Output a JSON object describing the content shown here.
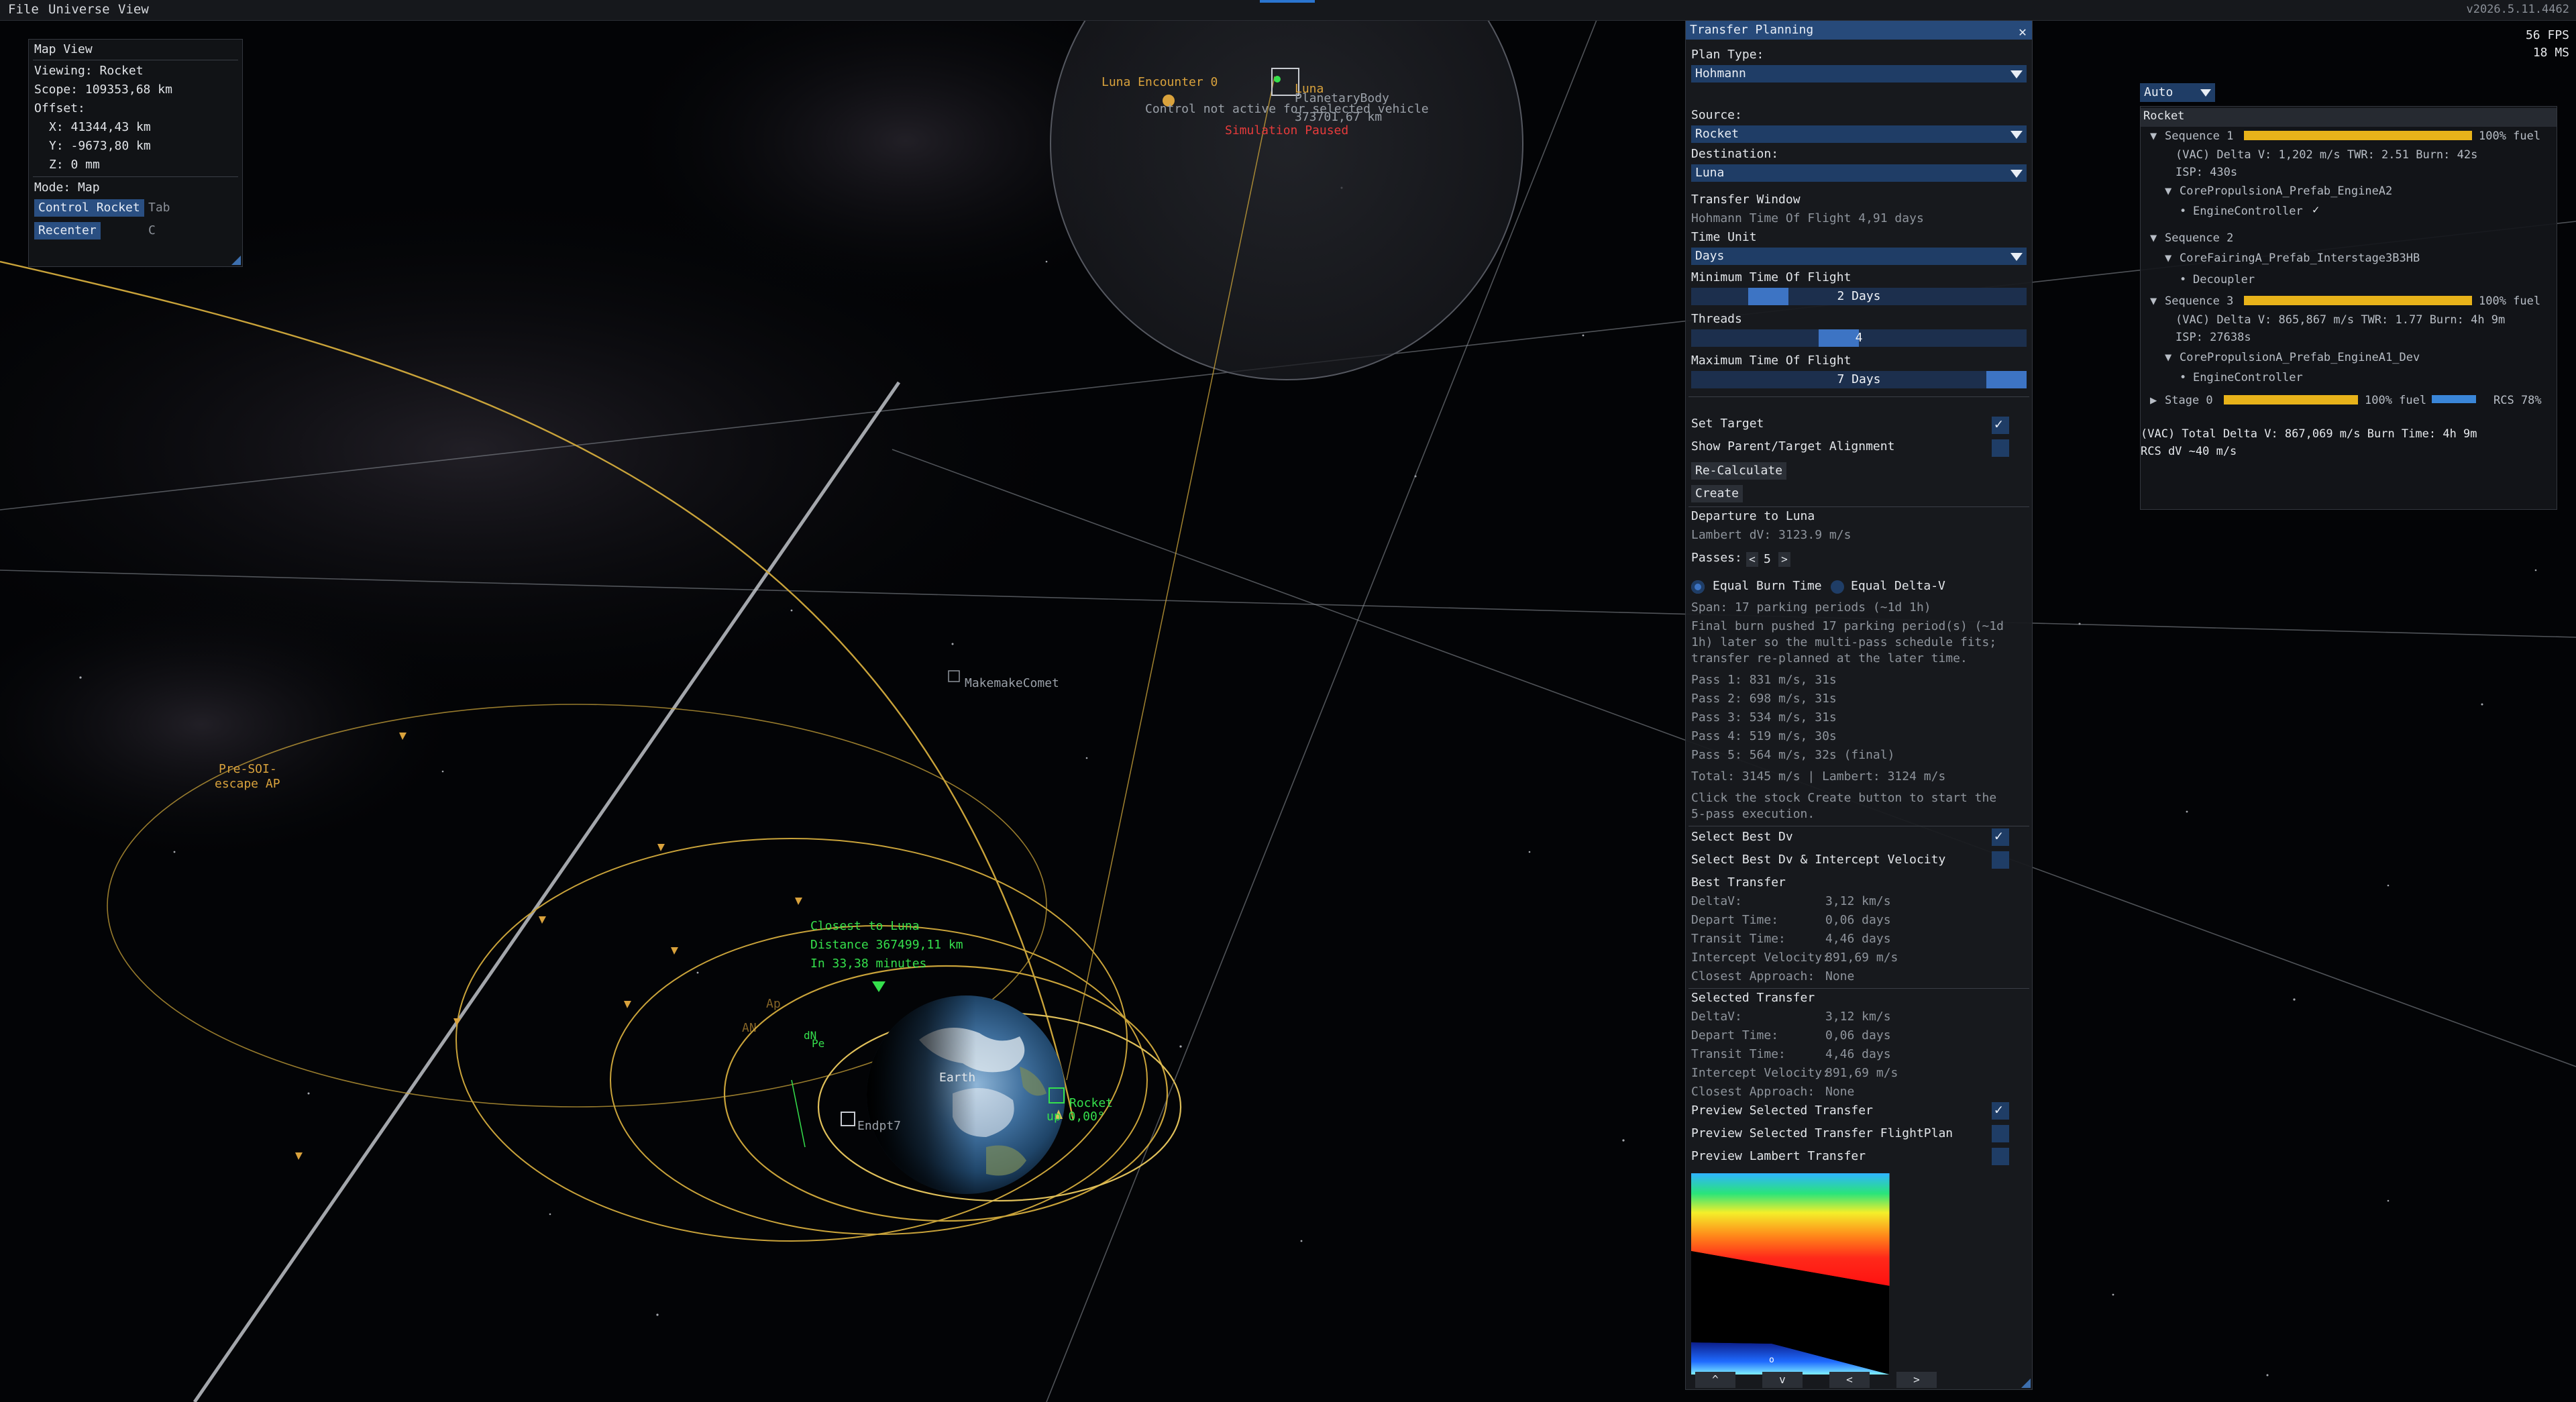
{
  "menu": {
    "file": "File",
    "universe": "Universe",
    "view": "View"
  },
  "version": "v2026.5.11.4462",
  "perf": {
    "fps": "56 FPS",
    "ms": "18 MS"
  },
  "map_view": {
    "title": "Map View",
    "viewing": "Viewing: Rocket",
    "scope": "Scope: 109353,68 km",
    "offset": "Offset:",
    "x": "X: 41344,43 km",
    "y": "Y: -9673,80 km",
    "z": "Z: 0 mm",
    "mode": "Mode: Map",
    "control_rocket": "Control Rocket",
    "control_key": "Tab",
    "recenter": "Recenter",
    "recenter_key": "C"
  },
  "scene": {
    "luna_encounter": "Luna Encounter 0",
    "luna": "Luna",
    "planetary_body": "PlanetaryBody",
    "distance": "373701,67 km",
    "control_not_active": "Control not active for selected vehicle",
    "sim_paused": "Simulation Paused",
    "makemake": "MakemakeComet",
    "pre_soi_1": "Pre-SOI-",
    "pre_soi_2": "escape AP",
    "closest_1": "Closest to Luna",
    "closest_2": "Distance 367499,11 km",
    "closest_3": "In 33,38 minutes",
    "earth": "Earth",
    "ap": "Ap",
    "an": "AN",
    "dn": "dN",
    "pe": "Pe",
    "rocket": "Rocket",
    "rocket_angle": "up 0,00°",
    "endpt": "Endpt7"
  },
  "transfer": {
    "title": "Transfer Planning",
    "plan_type_label": "Plan Type:",
    "plan_type": "Hohmann",
    "source_label": "Source:",
    "source": "Rocket",
    "destination_label": "Destination:",
    "destination": "Luna",
    "window_label": "Transfer Window",
    "hohmann_tof": "Hohmann Time Of Flight 4,91 days",
    "time_unit_label": "Time Unit",
    "time_unit": "Days",
    "min_tof_label": "Minimum Time Of Flight",
    "min_tof": "2 Days",
    "min_tof_frac": 0.29,
    "threads_label": "Threads",
    "threads": "4",
    "threads_frac": 0.5,
    "max_tof_label": "Maximum Time Of Flight",
    "max_tof": "7 Days",
    "max_tof_frac": 1.0,
    "set_target": "Set Target",
    "show_alignment": "Show Parent/Target Alignment",
    "recalculate": "Re-Calculate",
    "create": "Create",
    "departure": "Departure to Luna",
    "lambert_dv": "Lambert dV: 3123.9 m/s",
    "passes_label": "Passes:",
    "passes": "5",
    "equal_burn": "Equal Burn Time",
    "equal_dv": "Equal Delta-V",
    "span": "Span: 17 parking periods (~1d 1h)",
    "final_1": "Final burn pushed 17 parking period(s) (~1d",
    "final_2": "1h) later so the multi-pass schedule fits;",
    "final_3": "transfer re-planned at the later time.",
    "pass1": "Pass 1: 831 m/s, 31s",
    "pass2": "Pass 2: 698 m/s, 31s",
    "pass3": "Pass 3: 534 m/s, 31s",
    "pass4": "Pass 4: 519 m/s, 30s",
    "pass5": "Pass 5: 564 m/s, 32s (final)",
    "total": "Total: 3145 m/s | Lambert: 3124 m/s",
    "click_1": "Click the stock Create button to start the",
    "click_2": "5-pass execution.",
    "select_best_dv": "Select Best Dv",
    "select_best_dv_iv": "Select Best Dv & Intercept Velocity",
    "best_transfer": "Best Transfer",
    "selected_transfer": "Selected Transfer",
    "k_deltav": "DeltaV:",
    "k_depart": "Depart Time:",
    "k_transit": "Transit Time:",
    "k_intercept": "Intercept Velocity:",
    "k_closest": "Closest Approach:",
    "best": {
      "deltav": "3,12 km/s",
      "depart": "0,06 days",
      "transit": "4,46 days",
      "intercept": "891,69 m/s",
      "closest": "None"
    },
    "selected": {
      "deltav": "3,12 km/s",
      "depart": "0,06 days",
      "transit": "4,46 days",
      "intercept": "891,69 m/s",
      "closest": "None"
    },
    "preview_selected": "Preview Selected Transfer",
    "preview_flightplan": "Preview Selected Transfer FlightPlan",
    "preview_lambert": "Preview Lambert Transfer",
    "heat_marker": "o",
    "nav_up": "^",
    "nav_down": "v",
    "nav_left": "<",
    "nav_right": ">",
    "dec": "<",
    "inc": ">"
  },
  "staging": {
    "mode": "Auto",
    "vehicle": "Rocket",
    "seq1": "Sequence 1",
    "seq1_fuel": "100% fuel",
    "seq1_fill": 1.0,
    "seq1_vac": "(VAC) Delta V: 1,202 m/s  TWR: 2.51  Burn: 42s",
    "seq1_isp": "ISP: 430s",
    "engine_a2": "CorePropulsionA_Prefab_EngineA2",
    "engine_controller_1": "EngineController",
    "seq2": "Sequence 2",
    "fairing": "CoreFairingA_Prefab_Interstage3B3HB",
    "decoupler": "Decoupler",
    "seq3": "Sequence 3",
    "seq3_fuel": "100% fuel",
    "seq3_fill": 1.0,
    "seq3_vac": "(VAC) Delta V: 865,867 m/s  TWR: 1.77  Burn: 4h 9m",
    "seq3_isp": "ISP: 27638s",
    "engine_a1": "CorePropulsionA_Prefab_EngineA1_Dev",
    "engine_controller_2": "EngineController",
    "stage0": "Stage 0",
    "stage0_fuel": "100% fuel",
    "stage0_fill": 1.0,
    "rcs": "RCS 78%",
    "rcs_fill": 0.78,
    "total": "(VAC) Total Delta V: 867,069 m/s  Burn Time: 4h 9m",
    "rcs_dv": "RCS dV ~40 m/s"
  },
  "colors": {
    "accent": "#2a4f82",
    "orbit": "#c9a33a",
    "green": "#35e04c",
    "fuel": "#e8b31a"
  }
}
